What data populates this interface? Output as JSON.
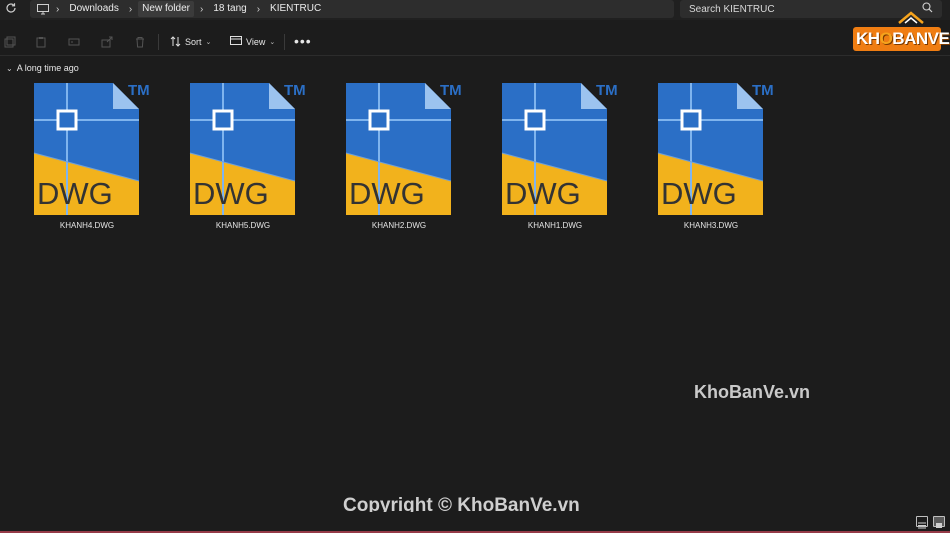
{
  "addressbar": {
    "breadcrumbs": [
      "Downloads",
      "New folder",
      "18 tang",
      "KIENTRUC"
    ],
    "search_placeholder": "Search KIENTRUC"
  },
  "toolbar": {
    "sort_label": "Sort",
    "view_label": "View",
    "more_label": "•••"
  },
  "group": {
    "label": "A long time ago"
  },
  "files": [
    {
      "name": "KHANH4.DWG",
      "type_label": "DWG",
      "tm": "TM"
    },
    {
      "name": "KHANH5.DWG",
      "type_label": "DWG",
      "tm": "TM"
    },
    {
      "name": "KHANH2.DWG",
      "type_label": "DWG",
      "tm": "TM"
    },
    {
      "name": "KHANH1.DWG",
      "type_label": "DWG",
      "tm": "TM"
    },
    {
      "name": "KHANH3.DWG",
      "type_label": "DWG",
      "tm": "TM"
    }
  ],
  "logo": {
    "text_1": "KH",
    "text_2": "O",
    "text_3": "BANVE"
  },
  "watermark": "KhoBanVe.vn",
  "copyright": "Copyright © KhoBanVe.vn",
  "colors": {
    "dwg_blue": "#2b6fc6",
    "dwg_yellow": "#f2b21c",
    "background": "#1c1c1c"
  }
}
